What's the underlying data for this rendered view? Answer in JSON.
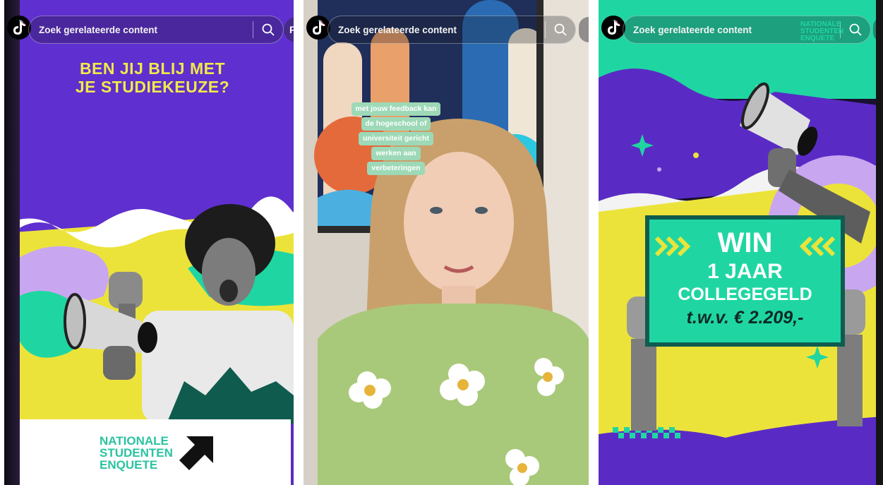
{
  "panels": [
    {
      "search_placeholder": "Zoek gerelateerde content",
      "side_button_label": "F",
      "headline_line1": "BEN JIJ BLIJ MET",
      "headline_line2": "JE STUDIEKEUZE?",
      "logo_line1": "NATIONALE",
      "logo_line2": "STUDENTEN",
      "logo_line3": "ENQUETE"
    },
    {
      "search_placeholder": "Zoek gerelateerde content",
      "caption_lines": [
        "met jouw feedback kan",
        "de hogeschool of",
        "universiteit gericht",
        "werken aan",
        "verbeteringen"
      ]
    },
    {
      "search_placeholder": "Zoek gerelateerde content",
      "logo_line1": "NATIONALE",
      "logo_line2": "STUDENTEN",
      "logo_line3": "ENQUETE",
      "sign_line1": "WIN",
      "sign_line2": "1 JAAR",
      "sign_line3": "COLLEGEGELD",
      "sign_line4": "t.w.v. € 2.209,-"
    }
  ],
  "colors": {
    "purple": "#5f2fcf",
    "yellow": "#f1e94a",
    "teal": "#1fd6a2",
    "dark_teal": "#0f5c4f",
    "lilac": "#c9a6f0"
  },
  "icons": [
    "tiktok-logo-icon",
    "search-icon",
    "megaphone-icon",
    "arrow-icon"
  ]
}
